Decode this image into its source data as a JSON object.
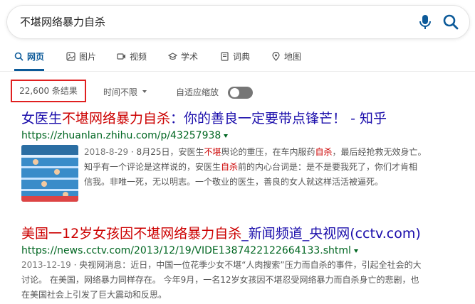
{
  "search": {
    "query": "不堪网络暴力自杀"
  },
  "tabs": [
    {
      "label": "网页",
      "icon": "search-icon"
    },
    {
      "label": "图片",
      "icon": "image-icon"
    },
    {
      "label": "视频",
      "icon": "video-icon"
    },
    {
      "label": "学术",
      "icon": "academic-icon"
    },
    {
      "label": "词典",
      "icon": "dictionary-icon"
    },
    {
      "label": "地图",
      "icon": "map-pin-icon"
    }
  ],
  "filters": {
    "result_count": "22,600 条结果",
    "time_filter": "时间不限",
    "adaptive_zoom": "自适应缩放"
  },
  "results": [
    {
      "title_pre": "女医生",
      "title_hl": "不堪网络暴力自杀",
      "title_post": "：你的善良一定要带点锋芒！ - 知乎",
      "url": "https://zhuanlan.zhihu.com/p/43257938",
      "date": "2018-8-29",
      "snippet_1": " · 8月25日，安医生",
      "snippet_hl_1": "不堪",
      "snippet_2": "舆论的重压，在车内服药",
      "snippet_hl_2": "自杀",
      "snippet_3": "，最后经抢救无效身亡。",
      "snippet_4": "知乎有一个评论是这样说的，安医生",
      "snippet_hl_3": "自杀",
      "snippet_5": "前的内心台词是：是不是要我死了，你们才肯相",
      "snippet_6": "信我。非唯一死，无以明志。一个敬业的医生，善良的女人就这样活活被逼死。"
    },
    {
      "title_pre": "美国一12岁女孩因",
      "title_hl": "不堪网络暴力自杀",
      "title_post": "_新闻频道_央视网(cctv.com)",
      "url": "https://news.cctv.com/2013/12/19/VIDE1387422122664133.shtml",
      "date": "2013-12-19",
      "snippet_1": " · 央视网消息：近日，中国一位花季少女不堪“人肉搜索”压力而自杀的事件，引起全社会的大",
      "snippet_2": "讨论。 在美国，网络暴力同样存在。 今年9月，一名12岁女孩因不堪忍受网络暴力而自杀身亡的悲剧，也",
      "snippet_3": "在美国社会上引发了巨大震动和反思。"
    }
  ],
  "colors": {
    "link": "#1a0dab",
    "highlight": "#cc0000",
    "url": "#006621",
    "accent": "#0c5a99",
    "count_border": "#e02020"
  }
}
